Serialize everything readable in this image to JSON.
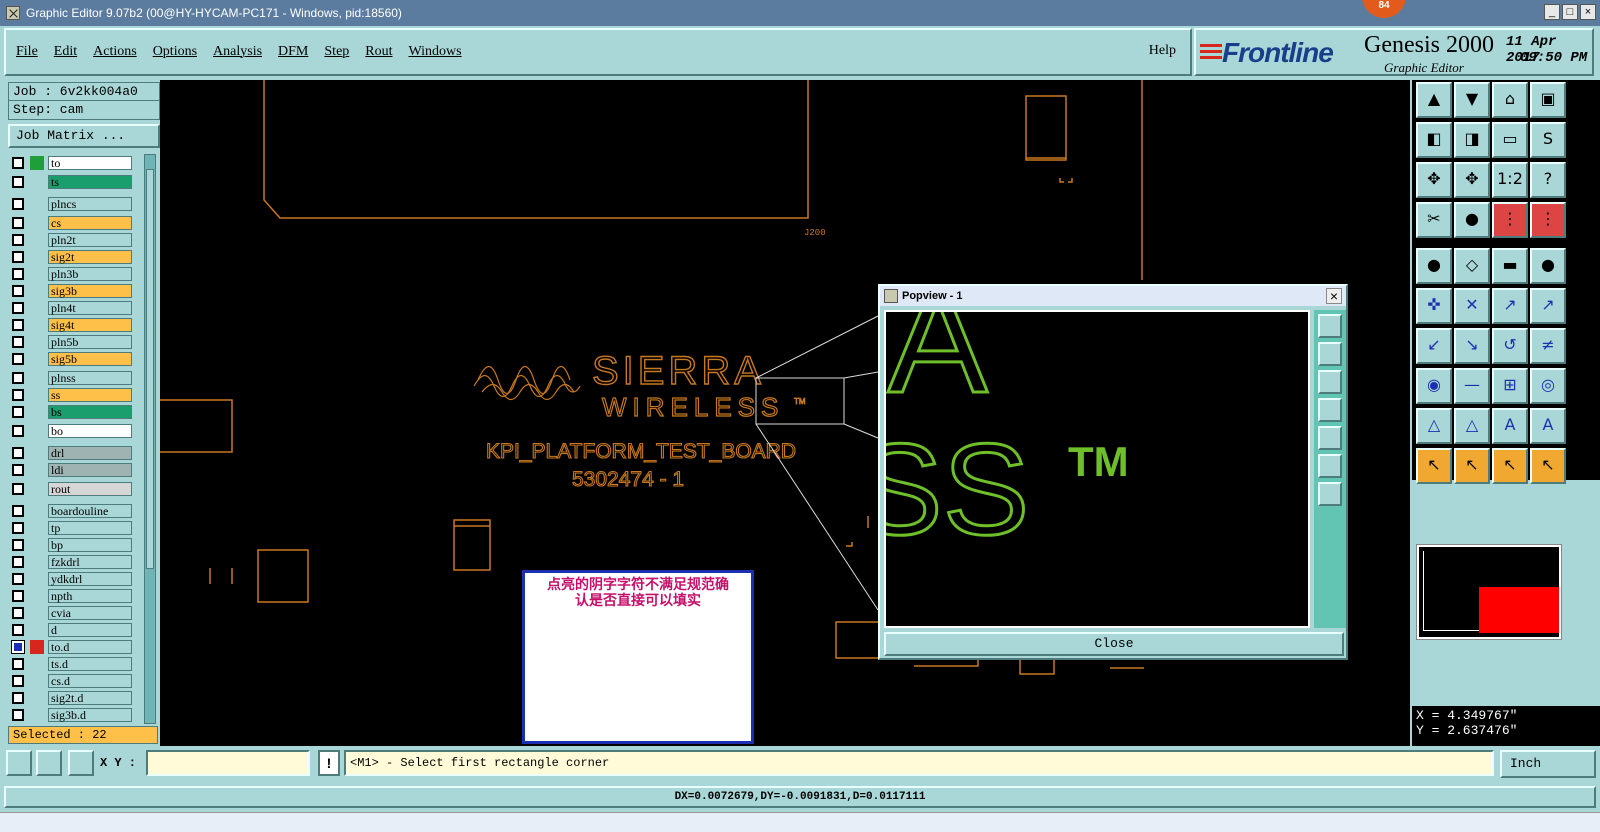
{
  "window": {
    "title": "Graphic Editor 9.07b2 (00@HY-HYCAM-PC171 - Windows, pid:18560)",
    "notif_count": "84"
  },
  "menu": [
    "File",
    "Edit",
    "Actions",
    "Options",
    "Analysis",
    "DFM",
    "Step",
    "Rout",
    "Windows"
  ],
  "help_label": "Help",
  "brand": {
    "logo": "Frontline",
    "product": "Genesis 2000",
    "subtitle": "Graphic Editor",
    "date": "11 Apr 2017",
    "time": "09:50 PM"
  },
  "job": {
    "job_label": "Job : 6v2kk004a0",
    "step_label": "Step: cam",
    "matrix_button": "Job Matrix ..."
  },
  "layers": [
    {
      "name": "to",
      "color": "#ffffff",
      "mark": "#1f9e3a"
    },
    {
      "name": "ts",
      "color": "#1a9e6e"
    },
    {
      "name": "plncs",
      "color": "#a9d7d7"
    },
    {
      "name": "cs",
      "color": "#ffc04a"
    },
    {
      "name": "pln2t",
      "color": "#a9d7d7"
    },
    {
      "name": "sig2t",
      "color": "#ffc04a"
    },
    {
      "name": "pln3b",
      "color": "#a9d7d7"
    },
    {
      "name": "sig3b",
      "color": "#ffc04a"
    },
    {
      "name": "pln4t",
      "color": "#a9d7d7"
    },
    {
      "name": "sig4t",
      "color": "#ffc04a"
    },
    {
      "name": "pln5b",
      "color": "#a9d7d7"
    },
    {
      "name": "sig5b",
      "color": "#ffc04a"
    },
    {
      "name": "plnss",
      "color": "#a9d7d7"
    },
    {
      "name": "ss",
      "color": "#ffc04a"
    },
    {
      "name": "bs",
      "color": "#1a9e6e"
    },
    {
      "name": "bo",
      "color": "#ffffff"
    },
    {
      "name": "drl",
      "color": "#9fb3b3"
    },
    {
      "name": "ldi",
      "color": "#9fb3b3"
    },
    {
      "name": "rout",
      "color": "#d6d6d6"
    },
    {
      "name": "boardouline",
      "color": "#a9d7d7"
    },
    {
      "name": "tp",
      "color": "#a9d7d7"
    },
    {
      "name": "bp",
      "color": "#a9d7d7"
    },
    {
      "name": "fzkdrl",
      "color": "#a9d7d7"
    },
    {
      "name": "ydkdrl",
      "color": "#a9d7d7"
    },
    {
      "name": "npth",
      "color": "#a9d7d7"
    },
    {
      "name": "cvia",
      "color": "#a9d7d7"
    },
    {
      "name": "d",
      "color": "#a9d7d7"
    },
    {
      "name": "to.d",
      "color": "#a9d7d7",
      "active": true
    },
    {
      "name": "ts.d",
      "color": "#a9d7d7"
    },
    {
      "name": "cs.d",
      "color": "#a9d7d7"
    },
    {
      "name": "sig2t.d",
      "color": "#a9d7d7"
    },
    {
      "name": "sig3b.d",
      "color": "#a9d7d7"
    }
  ],
  "selected": "Selected : 22",
  "board": {
    "logo_line1": "SIERRA",
    "logo_line2": "WIRELESS",
    "tm": "TM",
    "board_name": "KPI_PLATFORM_TEST_BOARD",
    "board_no": "5302474 - 1",
    "ref": "J200"
  },
  "popview": {
    "title": "Popview - 1",
    "close_label": "Close",
    "zoom_line1": "IA",
    "zoom_line2": "SS",
    "zoom_tm": "TM"
  },
  "note": {
    "line1": "点亮的阴字字符不满足规范确",
    "line2": "认是否直接可以填实"
  },
  "coords": {
    "x": "X = 4.349767\"",
    "y": "Y = 2.637476\""
  },
  "bottom": {
    "xy_label": "X Y :",
    "xy_value": "",
    "prompt": "<M1> - Select first rectangle corner",
    "units": "Inch",
    "status": "DX=0.0072679,DY=-0.0091831,D=0.0117111"
  },
  "colors": {
    "panel": "#a9d7d7",
    "orange_outline": "#c8781e",
    "zoom_green": "#6fbf2a",
    "note_text": "#c5106b"
  }
}
